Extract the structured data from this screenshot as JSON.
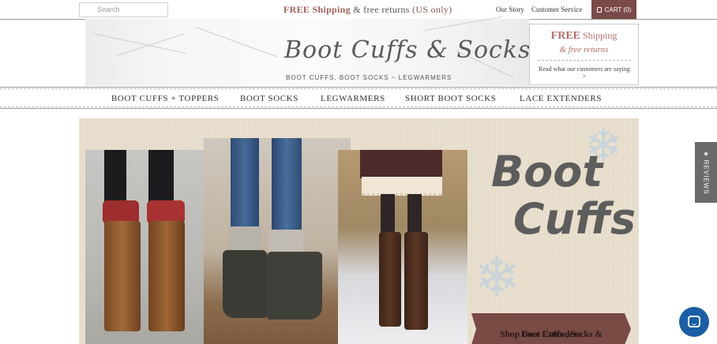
{
  "topbar": {
    "search_placeholder": "Search",
    "promo_free": "FREE Shipping",
    "promo_amp": " & free returns ",
    "promo_us": "(US only)",
    "links": [
      "Our Story",
      "Customer Service"
    ],
    "cart_label": "CART (0)"
  },
  "header": {
    "logo_text": "Boot Cuffs & Socks",
    "tagline": "BOOT CUFFS, BOOT SOCKS ~ LEGWARMERS",
    "reviews_box": {
      "free_bold": "FREE",
      "free_rest": " Shipping",
      "returns": "& free returns",
      "read_reviews": "Read what our customers are saying >"
    }
  },
  "nav": {
    "items": [
      "BOOT CUFFS + TOPPERS",
      "BOOT SOCKS",
      "LEGWARMERS",
      "SHORT BOOT SOCKS",
      "LACE EXTENDERS"
    ]
  },
  "hero": {
    "title_line1": "Boot",
    "title_line2": "Cuffs",
    "cta_line1": "Shop Boot Cuffs , Socks &",
    "cta_line2": "Lace Extenders"
  },
  "side_tab": {
    "label": "★ REVIEWS"
  },
  "colors": {
    "cart_bg": "#7a4a48",
    "accent_rose": "#b27069",
    "cta_bg": "#7a4a44",
    "chat_bg": "#1b5ea5",
    "side_tab_bg": "#6a6a6a"
  },
  "icons": {
    "cart": "shopping-bag-icon",
    "chat": "chat-bubble-icon",
    "snowflake": "snowflake-icon"
  }
}
